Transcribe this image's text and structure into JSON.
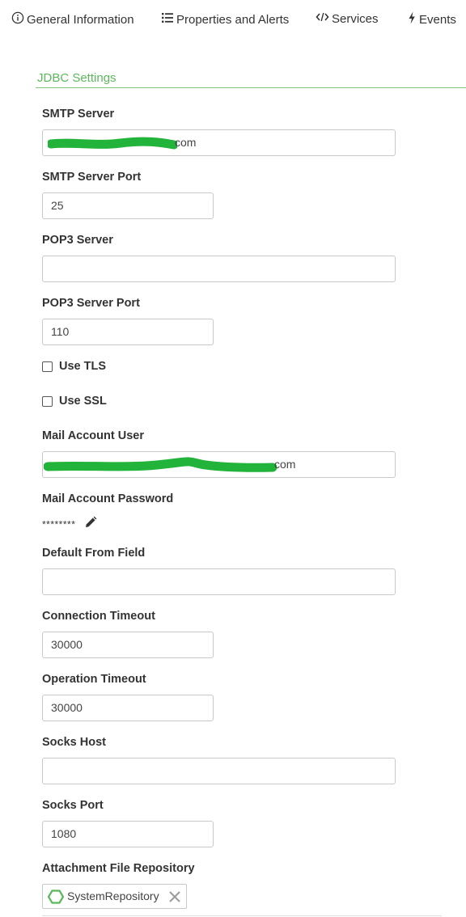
{
  "tabs": [
    {
      "label": "General Information",
      "icon": "info-icon"
    },
    {
      "label": "Properties and Alerts",
      "icon": "list-icon"
    },
    {
      "label": "Services",
      "icon": "code-icon"
    },
    {
      "label": "Events",
      "icon": "bolt-icon"
    }
  ],
  "section": {
    "title": "JDBC Settings",
    "accent_color": "#5cb85c"
  },
  "fields": {
    "smtp_server": {
      "label": "SMTP Server",
      "value_suffix": "com"
    },
    "smtp_port": {
      "label": "SMTP Server Port",
      "value": "25"
    },
    "pop3_server": {
      "label": "POP3 Server",
      "value": ""
    },
    "pop3_port": {
      "label": "POP3 Server Port",
      "value": "110"
    },
    "use_tls": {
      "label": "Use TLS",
      "checked": false
    },
    "use_ssl": {
      "label": "Use SSL",
      "checked": false
    },
    "mail_user": {
      "label": "Mail Account User",
      "value_suffix": "com"
    },
    "mail_password": {
      "label": "Mail Account Password",
      "masked": "********"
    },
    "default_from": {
      "label": "Default From Field",
      "value": ""
    },
    "connection_timeout": {
      "label": "Connection Timeout",
      "value": "30000"
    },
    "operation_timeout": {
      "label": "Operation Timeout",
      "value": "30000"
    },
    "socks_host": {
      "label": "Socks Host",
      "value": ""
    },
    "socks_port": {
      "label": "Socks Port",
      "value": "1080"
    },
    "attachment_repo": {
      "label": "Attachment File Repository",
      "value": "SystemRepository"
    }
  },
  "colors": {
    "redaction": "#22b33a",
    "repo_icon": "#5cb85c"
  }
}
